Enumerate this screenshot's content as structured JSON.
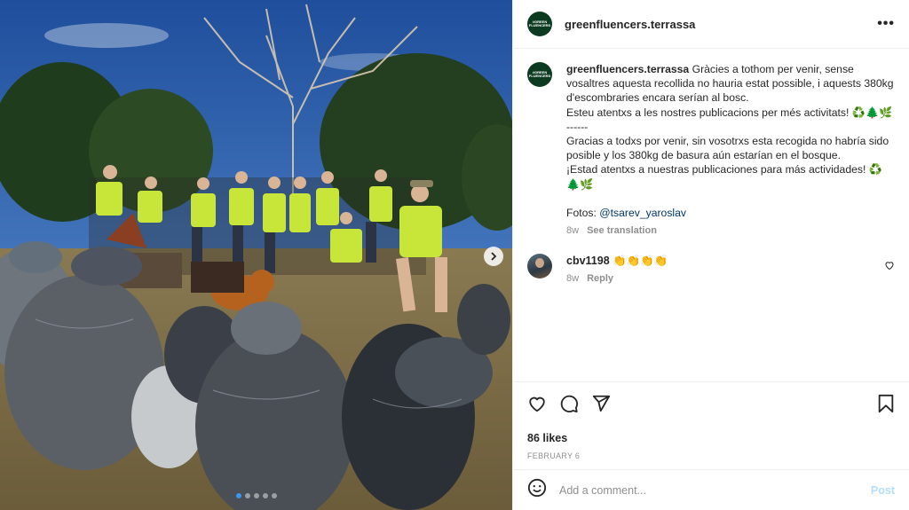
{
  "post": {
    "username": "greenfluencers.terrassa",
    "avatar_text": "#GREEN FLUENCERS",
    "more_icon": "more-horizontal-icon",
    "caption_catalan": "Gràcies a tothom per venir, sense vosaltres aquesta recollida no hauria estat possible, i aquests 380kg d'escombraries encara serían al bosc.\nEsteu atentxs a les nostres publicacions per més activitats! ♻️🌲🌿",
    "caption_separator": "------",
    "caption_spanish": "Gracias a todxs por venir, sin vosotrxs esta recogida no habría sido posible y los 380kg de basura aún estarían en el bosque.\n¡Estad atentxs a nuestras publicaciones para más actividades! ♻️🌲🌿",
    "fotos_label": "Fotos:",
    "fotos_handle": "@tsarev_yaroslav",
    "age": "8w",
    "translate_label": "See translation"
  },
  "comment": {
    "username": "cbv1198",
    "text": "👏👏👏👏",
    "age": "8w",
    "reply_label": "Reply"
  },
  "actions": {
    "likes": "86 likes",
    "date": "FEBRUARY 6"
  },
  "add_comment": {
    "placeholder": "Add a comment...",
    "post_label": "Post"
  },
  "carousel": {
    "slides": 5,
    "active_index": 0
  },
  "colors": {
    "link": "#00376b",
    "muted": "#8e8e8e",
    "post_disabled": "#b2dffc",
    "carousel_active": "#3897f0",
    "avatar_bg": "#0d3b21"
  }
}
